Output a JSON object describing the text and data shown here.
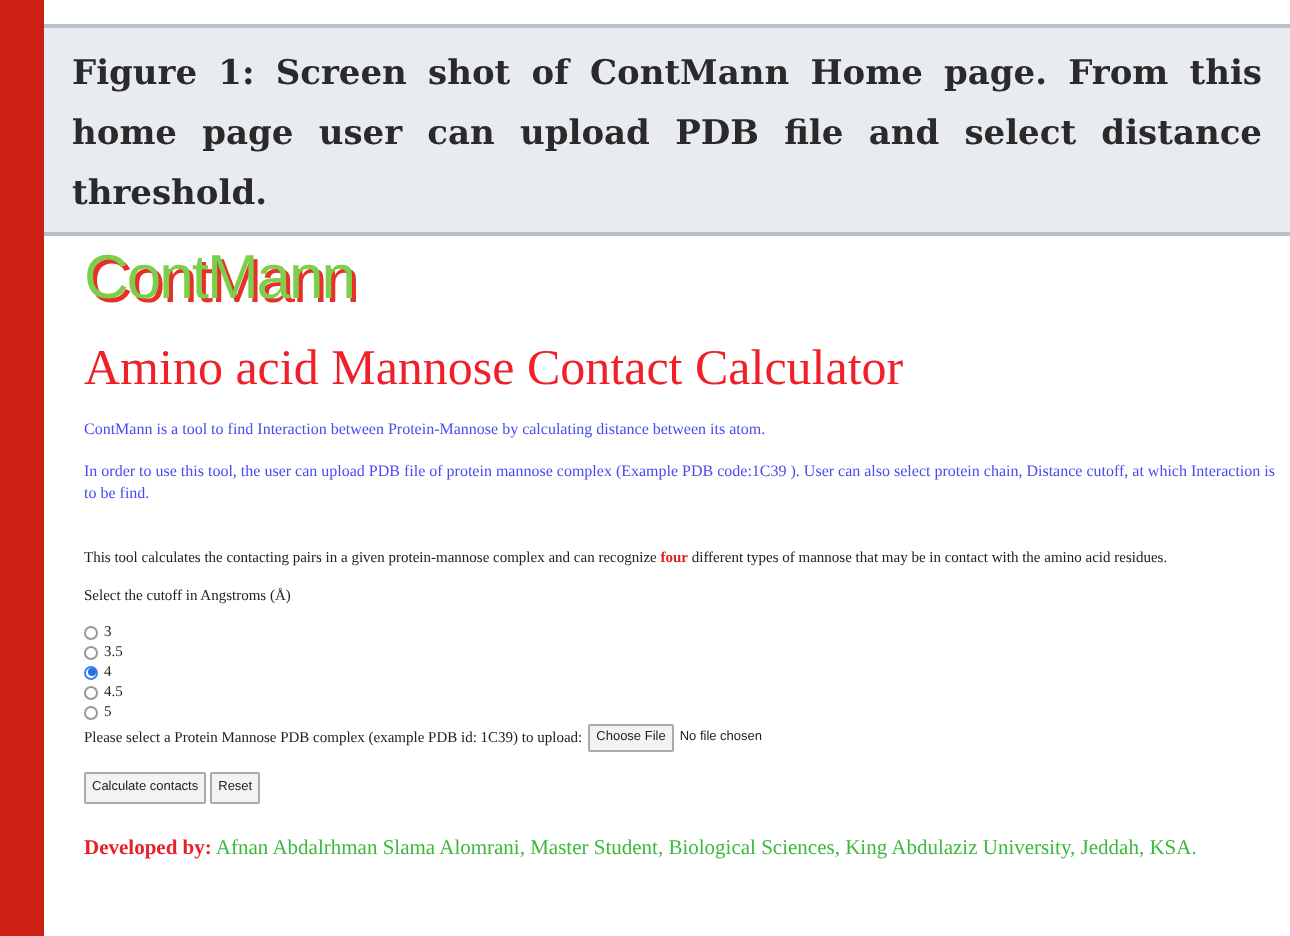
{
  "caption": {
    "label": "Figure 1:",
    "text": "Screen shot of ContMann Home page. From this home page user can upload PDB file and select distance threshold."
  },
  "app": {
    "logo": "ContMann",
    "title": "Amino acid Mannose Contact Calculator",
    "intro": "ContMann is a tool to find Interaction between Protein-Mannose by calculating distance between its atom.",
    "usage": "In order to use this tool, the user can upload PDB file of protein mannose complex (Example PDB code:1C39 ). User can also select protein chain, Distance cutoff, at which Interaction is to be find.",
    "description": {
      "before": "This tool calculates the contacting pairs in a given protein-mannose complex and can recognize",
      "highlight": "four",
      "after": "different types of mannose that may be in contact with the amino acid residues."
    },
    "cutoff_label": "Select the cutoff in Angstroms (Å)",
    "cutoffs": [
      {
        "label": "3",
        "selected": false
      },
      {
        "label": "3.5",
        "selected": false
      },
      {
        "label": "4",
        "selected": true
      },
      {
        "label": "4.5",
        "selected": false
      },
      {
        "label": "5",
        "selected": false
      }
    ],
    "upload": {
      "label": "Please select a Protein Mannose PDB complex (example PDB id: 1C39) to upload:",
      "button": "Choose File",
      "status": "No file chosen"
    },
    "buttons": [
      "Calculate contacts",
      "Reset"
    ],
    "developer": {
      "label": "Developed by:",
      "text": "Afnan Abdalrhman Slama Alomrani, Master Student, Biological Sciences, King Abdulaziz University, Jeddah, KSA."
    }
  }
}
